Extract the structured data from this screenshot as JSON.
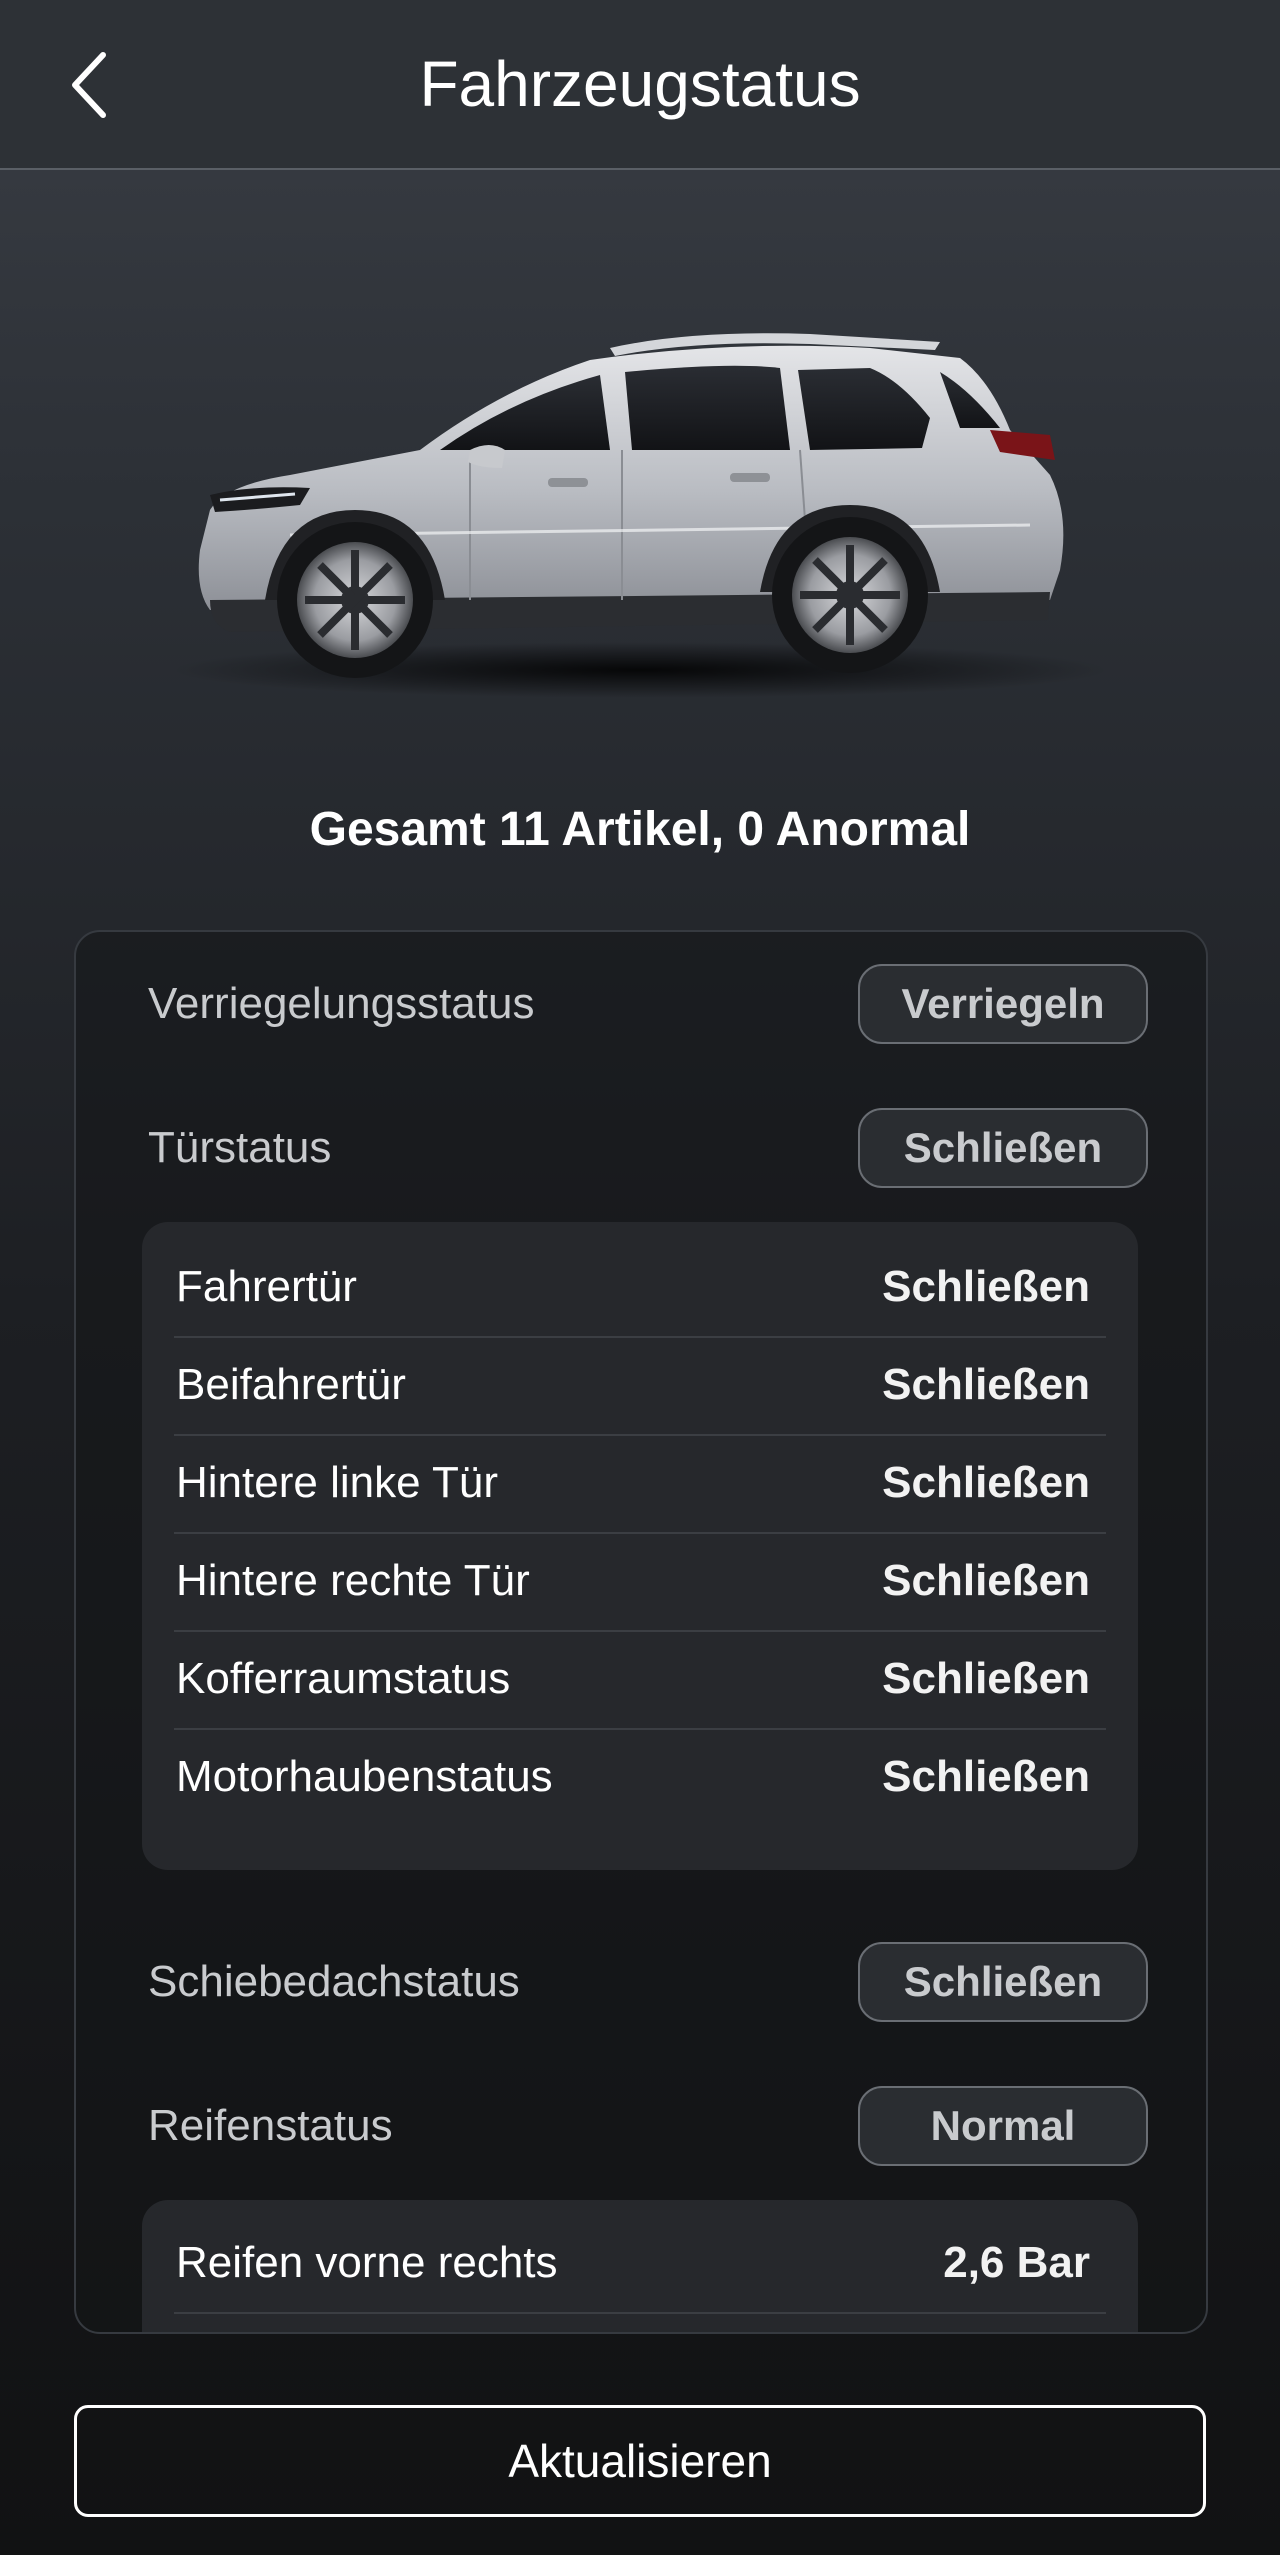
{
  "header": {
    "title": "Fahrzeugstatus",
    "back_icon": "chevron-left-icon"
  },
  "vehicle_image": "silver-suv-side-view",
  "summary": "Gesamt 11 Artikel, 0 Anormal",
  "lock_status": {
    "label": "Verriegelungsstatus",
    "value": "Verriegeln"
  },
  "door_status": {
    "label": "Türstatus",
    "value": "Schließen",
    "items": [
      {
        "label": "Fahrertür",
        "value": "Schließen"
      },
      {
        "label": "Beifahrertür",
        "value": "Schließen"
      },
      {
        "label": "Hintere linke Tür",
        "value": "Schließen"
      },
      {
        "label": "Hintere rechte Tür",
        "value": "Schließen"
      },
      {
        "label": "Kofferraumstatus",
        "value": "Schließen"
      },
      {
        "label": "Motorhaubenstatus",
        "value": "Schließen"
      }
    ]
  },
  "sunroof_status": {
    "label": "Schiebedachstatus",
    "value": "Schließen"
  },
  "tire_status": {
    "label": "Reifenstatus",
    "value": "Normal",
    "items": [
      {
        "label": "Reifen vorne rechts",
        "value": "2,6 Bar"
      }
    ]
  },
  "refresh_button": "Aktualisieren",
  "colors": {
    "background_top": "#3a3e45",
    "background_bottom": "#111213",
    "pill_border": "#6a6e74",
    "text_primary": "#ffffff",
    "text_secondary": "#c9cbce"
  }
}
